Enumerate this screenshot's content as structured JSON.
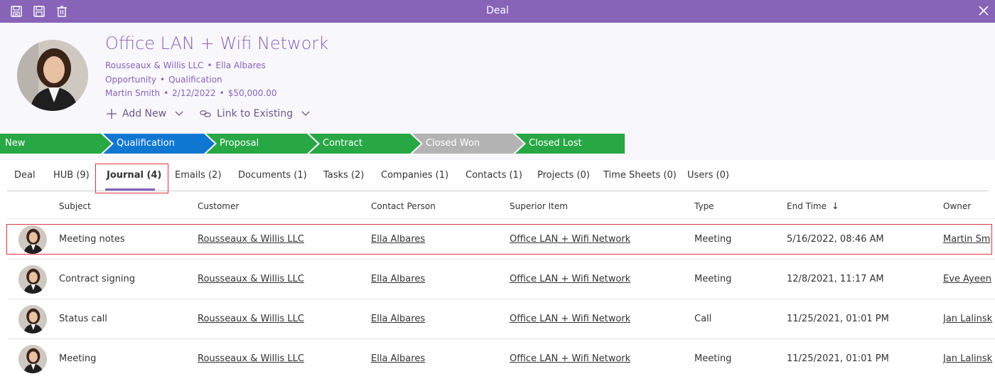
{
  "window": {
    "title": "Deal"
  },
  "deal": {
    "title": "Office LAN + Wifi Network",
    "company": "Rousseaux & Willis LLC",
    "contact": "Ella Albares",
    "category": "Opportunity",
    "stage": "Qualification",
    "owner": "Martin Smith",
    "date": "2/12/2022",
    "amount": "$50,000.00"
  },
  "actions": {
    "add_new": "Add New",
    "link_existing": "Link to Existing"
  },
  "stages": [
    {
      "label": "New",
      "color": "#28a745"
    },
    {
      "label": "Qualification",
      "color": "#0e77d1"
    },
    {
      "label": "Proposal",
      "color": "#28a745"
    },
    {
      "label": "Contract",
      "color": "#28a745"
    },
    {
      "label": "Closed Won",
      "color": "#b3b3b3"
    },
    {
      "label": "Closed Lost",
      "color": "#28a745"
    }
  ],
  "tabs": [
    "Deal",
    "HUB (9)",
    "Journal (4)",
    "Emails (2)",
    "Documents (1)",
    "Tasks (2)",
    "Companies (1)",
    "Contacts (1)",
    "Projects (0)",
    "Time Sheets (0)",
    "Users (0)"
  ],
  "columns": [
    "Subject",
    "Customer",
    "Contact Person",
    "Superior Item",
    "Type",
    "End Time",
    "Owner"
  ],
  "sort_indicator": "↓",
  "rows": [
    {
      "subject": "Meeting notes",
      "customer": "Rousseaux & Willis LLC",
      "contact": "Ella Albares",
      "superior": "Office LAN + Wifi Network",
      "type": "Meeting",
      "end": "5/16/2022, 08:46 AM",
      "owner": "Martin Sm"
    },
    {
      "subject": "Contract signing",
      "customer": "Rousseaux & Willis LLC",
      "contact": "Ella Albares",
      "superior": "Office LAN + Wifi Network",
      "type": "Meeting",
      "end": "12/8/2021, 11:17 AM",
      "owner": "Eve Ayeen"
    },
    {
      "subject": "Status call",
      "customer": "Rousseaux & Willis LLC",
      "contact": "Ella Albares",
      "superior": "Office LAN + Wifi Network",
      "type": "Call",
      "end": "11/25/2021, 01:01 PM",
      "owner": "Jan Lalinsk"
    },
    {
      "subject": "Meeting",
      "customer": "Rousseaux & Willis LLC",
      "contact": "Ella Albares",
      "superior": "Office LAN + Wifi Network",
      "type": "Meeting",
      "end": "11/25/2021, 01:01 PM",
      "owner": "Jan Lalinsk"
    }
  ],
  "colors": {
    "accent": "#8764b8",
    "highlight": "#e0343b"
  }
}
